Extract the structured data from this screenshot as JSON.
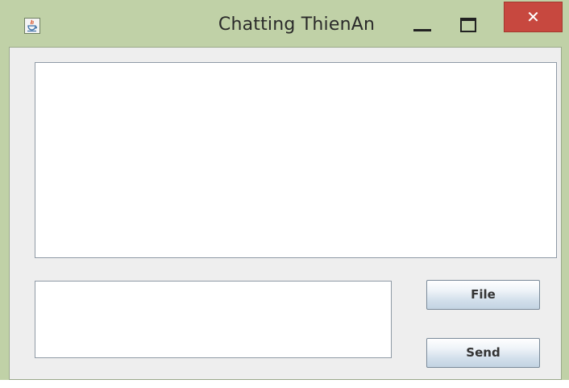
{
  "window": {
    "title": "Chatting ThienAn",
    "controls": {
      "minimize_icon": "minimize-icon",
      "maximize_icon": "maximize-icon",
      "close_icon": "close-icon",
      "close_glyph": "✕"
    },
    "app_icon": "java-icon"
  },
  "chat": {
    "history_value": "",
    "message_value": ""
  },
  "buttons": {
    "file_label": "File",
    "send_label": "Send"
  },
  "colors": {
    "titlebar": "#c0d1a7",
    "close_button": "#c7483f",
    "panel_background": "#eeeeee"
  }
}
